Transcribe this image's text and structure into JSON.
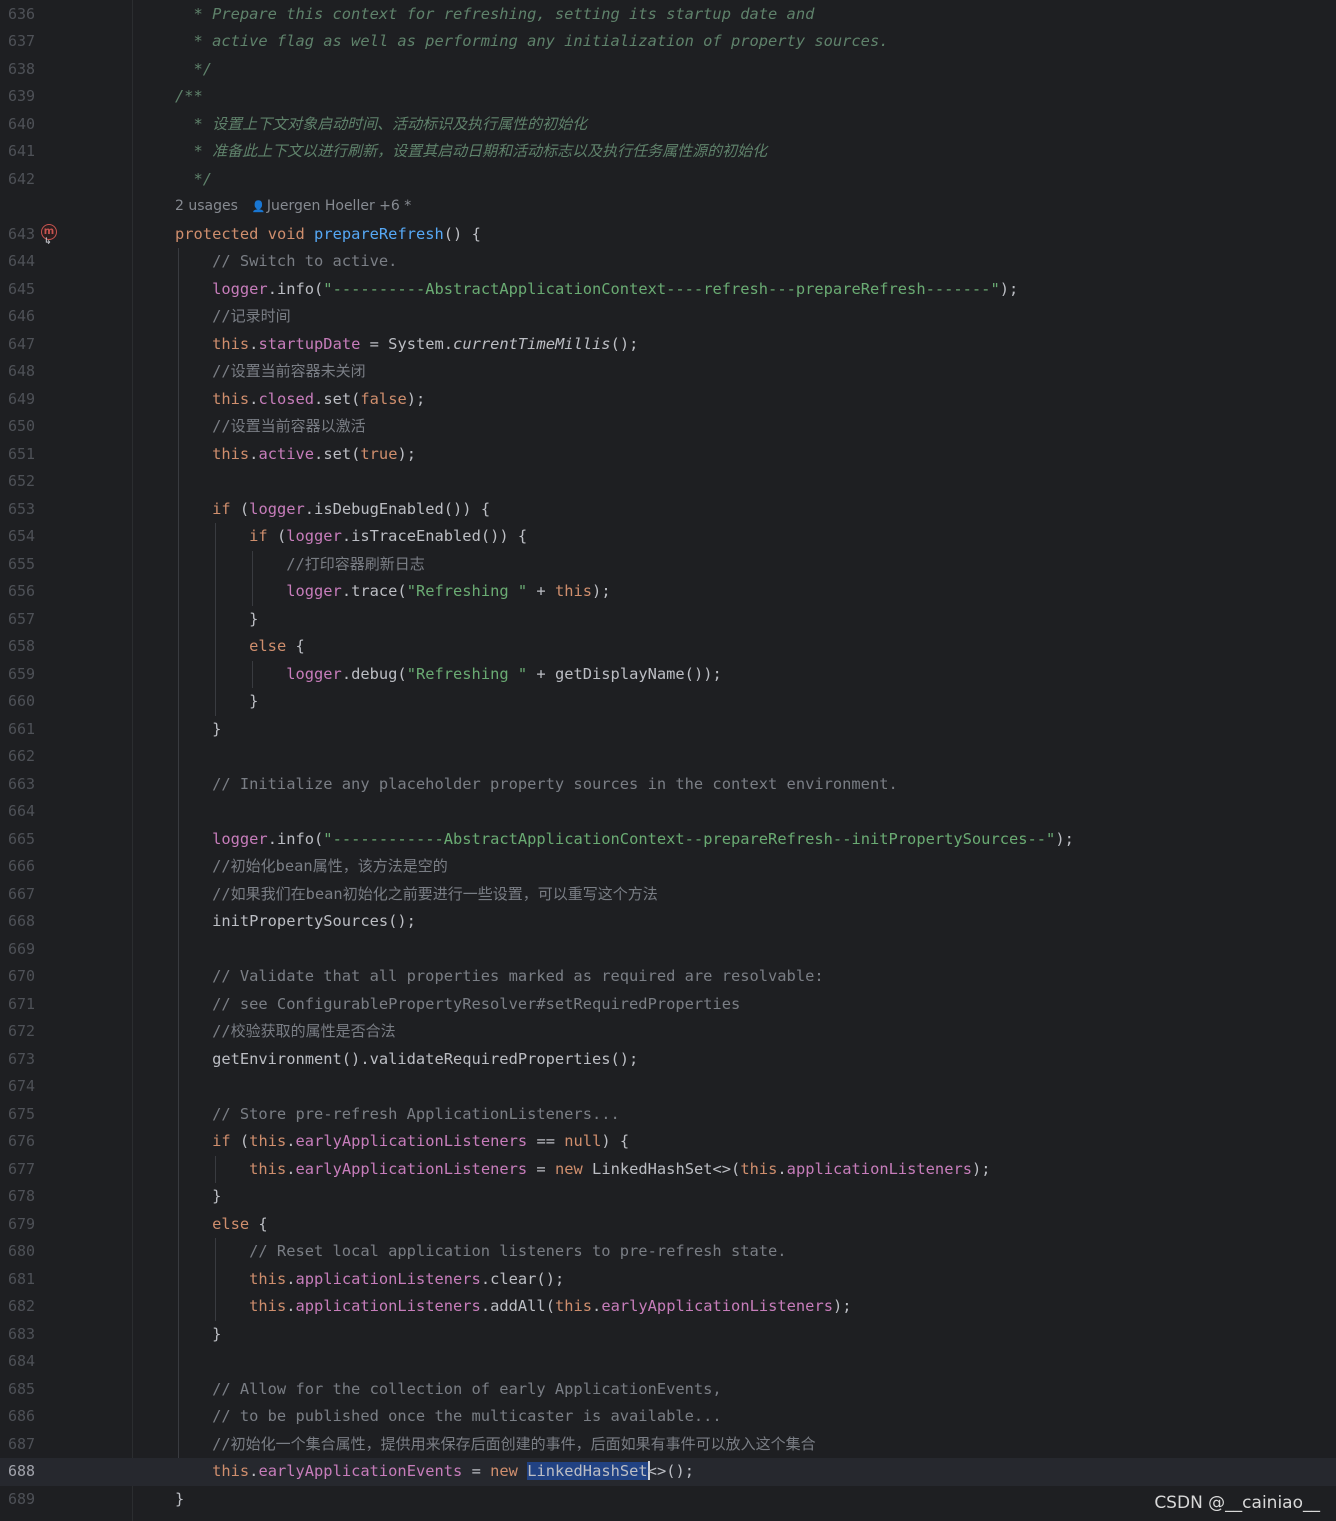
{
  "editor": {
    "inlay": {
      "usages": "2 usages",
      "author": "Juergen Hoeller +6 *"
    },
    "gutter_icon_label": "m",
    "current_line": 688,
    "lines": [
      {
        "n": "636",
        "t": [
          [
            "  * Prepare this context for refreshing, setting its startup date and",
            "doc"
          ]
        ]
      },
      {
        "n": "637",
        "t": [
          [
            "  * active flag as well as performing any initialization of property sources.",
            "doc"
          ]
        ]
      },
      {
        "n": "638",
        "t": [
          [
            "  */",
            "doc"
          ]
        ]
      },
      {
        "n": "639",
        "t": [
          [
            "/**",
            "doc"
          ]
        ]
      },
      {
        "n": "640",
        "t": [
          [
            "  * ",
            "doc"
          ],
          [
            "设置上下文对象启动时间、活动标识及执行属性的初始化",
            "doc-cjk"
          ]
        ]
      },
      {
        "n": "641",
        "t": [
          [
            "  * ",
            "doc"
          ],
          [
            "准备此上下文以进行刷新，设置其启动日期和活动标志以及执行任务属性源的初始化",
            "doc-cjk"
          ]
        ]
      },
      {
        "n": "642",
        "t": [
          [
            "  */",
            "doc"
          ]
        ]
      },
      {
        "n": "643",
        "t": [
          [
            "protected",
            "kw"
          ],
          [
            " ",
            ""
          ],
          [
            "void",
            "kw"
          ],
          [
            " ",
            ""
          ],
          [
            "prepareRefresh",
            "fn"
          ],
          [
            "() {",
            ""
          ]
        ]
      },
      {
        "n": "644",
        "t": [
          [
            "    // Switch to active.",
            "cmt"
          ]
        ]
      },
      {
        "n": "645",
        "t": [
          [
            "    ",
            ""
          ],
          [
            "logger",
            "fld"
          ],
          [
            ".info(",
            ""
          ],
          [
            "\"----------AbstractApplicationContext----refresh---prepareRefresh-------\"",
            "str"
          ],
          [
            ");",
            ""
          ]
        ]
      },
      {
        "n": "646",
        "t": [
          [
            "    //",
            "cmt"
          ],
          [
            "记录时间",
            "cmt-cjk"
          ]
        ]
      },
      {
        "n": "647",
        "t": [
          [
            "    ",
            ""
          ],
          [
            "this",
            "kw"
          ],
          [
            ".",
            ""
          ],
          [
            "startupDate",
            "fld"
          ],
          [
            " = System.",
            ""
          ],
          [
            "currentTimeMillis",
            "ital"
          ],
          [
            "();",
            ""
          ]
        ]
      },
      {
        "n": "648",
        "t": [
          [
            "    //",
            "cmt"
          ],
          [
            "设置当前容器未关闭",
            "cmt-cjk"
          ]
        ]
      },
      {
        "n": "649",
        "t": [
          [
            "    ",
            ""
          ],
          [
            "this",
            "kw"
          ],
          [
            ".",
            ""
          ],
          [
            "closed",
            "fld"
          ],
          [
            ".set(",
            ""
          ],
          [
            "false",
            "kw"
          ],
          [
            ");",
            ""
          ]
        ]
      },
      {
        "n": "650",
        "t": [
          [
            "    //",
            "cmt"
          ],
          [
            "设置当前容器以激活",
            "cmt-cjk"
          ]
        ]
      },
      {
        "n": "651",
        "t": [
          [
            "    ",
            ""
          ],
          [
            "this",
            "kw"
          ],
          [
            ".",
            ""
          ],
          [
            "active",
            "fld"
          ],
          [
            ".set(",
            ""
          ],
          [
            "true",
            "kw"
          ],
          [
            ");",
            ""
          ]
        ]
      },
      {
        "n": "652",
        "t": []
      },
      {
        "n": "653",
        "t": [
          [
            "    ",
            ""
          ],
          [
            "if",
            "kw"
          ],
          [
            " (",
            ""
          ],
          [
            "logger",
            "fld"
          ],
          [
            ".isDebugEnabled()) {",
            ""
          ]
        ]
      },
      {
        "n": "654",
        "t": [
          [
            "        ",
            ""
          ],
          [
            "if",
            "kw"
          ],
          [
            " (",
            ""
          ],
          [
            "logger",
            "fld"
          ],
          [
            ".isTraceEnabled()) {",
            ""
          ]
        ]
      },
      {
        "n": "655",
        "t": [
          [
            "            //",
            "cmt"
          ],
          [
            "打印容器刷新日志",
            "cmt-cjk"
          ]
        ]
      },
      {
        "n": "656",
        "t": [
          [
            "            ",
            ""
          ],
          [
            "logger",
            "fld"
          ],
          [
            ".trace(",
            ""
          ],
          [
            "\"Refreshing \"",
            "str"
          ],
          [
            " + ",
            ""
          ],
          [
            "this",
            "kw"
          ],
          [
            ");",
            ""
          ]
        ]
      },
      {
        "n": "657",
        "t": [
          [
            "        }",
            ""
          ]
        ]
      },
      {
        "n": "658",
        "t": [
          [
            "        ",
            ""
          ],
          [
            "else",
            "kw"
          ],
          [
            " {",
            ""
          ]
        ]
      },
      {
        "n": "659",
        "t": [
          [
            "            ",
            ""
          ],
          [
            "logger",
            "fld"
          ],
          [
            ".debug(",
            ""
          ],
          [
            "\"Refreshing \"",
            "str"
          ],
          [
            " + getDisplayName());",
            ""
          ]
        ]
      },
      {
        "n": "660",
        "t": [
          [
            "        }",
            ""
          ]
        ]
      },
      {
        "n": "661",
        "t": [
          [
            "    }",
            ""
          ]
        ]
      },
      {
        "n": "662",
        "t": []
      },
      {
        "n": "663",
        "t": [
          [
            "    // Initialize any placeholder property sources in the context environment.",
            "cmt"
          ]
        ]
      },
      {
        "n": "664",
        "t": []
      },
      {
        "n": "665",
        "t": [
          [
            "    ",
            ""
          ],
          [
            "logger",
            "fld"
          ],
          [
            ".info(",
            ""
          ],
          [
            "\"------------AbstractApplicationContext--prepareRefresh--initPropertySources--\"",
            "str"
          ],
          [
            ");",
            ""
          ]
        ]
      },
      {
        "n": "666",
        "t": [
          [
            "    //",
            "cmt"
          ],
          [
            "初始化",
            "cmt-cjk"
          ],
          [
            "bean",
            "cmt"
          ],
          [
            "属性，该方法是空的",
            "cmt-cjk"
          ]
        ]
      },
      {
        "n": "667",
        "t": [
          [
            "    //",
            "cmt"
          ],
          [
            "如果我们在",
            "cmt-cjk"
          ],
          [
            "bean",
            "cmt"
          ],
          [
            "初始化之前要进行一些设置，可以重写这个方法",
            "cmt-cjk"
          ]
        ]
      },
      {
        "n": "668",
        "t": [
          [
            "    initPropertySources();",
            ""
          ]
        ]
      },
      {
        "n": "669",
        "t": []
      },
      {
        "n": "670",
        "t": [
          [
            "    // Validate that all properties marked as required are resolvable:",
            "cmt"
          ]
        ]
      },
      {
        "n": "671",
        "t": [
          [
            "    // see ConfigurablePropertyResolver#setRequiredProperties",
            "cmt"
          ]
        ]
      },
      {
        "n": "672",
        "t": [
          [
            "    //",
            "cmt"
          ],
          [
            "校验获取的属性是否合法",
            "cmt-cjk"
          ]
        ]
      },
      {
        "n": "673",
        "t": [
          [
            "    getEnvironment().validateRequiredProperties();",
            ""
          ]
        ]
      },
      {
        "n": "674",
        "t": []
      },
      {
        "n": "675",
        "t": [
          [
            "    // Store pre-refresh ApplicationListeners...",
            "cmt"
          ]
        ]
      },
      {
        "n": "676",
        "t": [
          [
            "    ",
            ""
          ],
          [
            "if",
            "kw"
          ],
          [
            " (",
            ""
          ],
          [
            "this",
            "kw"
          ],
          [
            ".",
            ""
          ],
          [
            "earlyApplicationListeners",
            "fld"
          ],
          [
            " == ",
            ""
          ],
          [
            "null",
            "kw"
          ],
          [
            ") {",
            ""
          ]
        ]
      },
      {
        "n": "677",
        "t": [
          [
            "        ",
            ""
          ],
          [
            "this",
            "kw"
          ],
          [
            ".",
            ""
          ],
          [
            "earlyApplicationListeners",
            "fld"
          ],
          [
            " = ",
            ""
          ],
          [
            "new",
            "kw"
          ],
          [
            " LinkedHashSet<>(",
            ""
          ],
          [
            "this",
            "kw"
          ],
          [
            ".",
            ""
          ],
          [
            "applicationListeners",
            "fld"
          ],
          [
            ");",
            ""
          ]
        ]
      },
      {
        "n": "678",
        "t": [
          [
            "    }",
            ""
          ]
        ]
      },
      {
        "n": "679",
        "t": [
          [
            "    ",
            ""
          ],
          [
            "else",
            "kw"
          ],
          [
            " {",
            ""
          ]
        ]
      },
      {
        "n": "680",
        "t": [
          [
            "        // Reset local application listeners to pre-refresh state.",
            "cmt"
          ]
        ]
      },
      {
        "n": "681",
        "t": [
          [
            "        ",
            ""
          ],
          [
            "this",
            "kw"
          ],
          [
            ".",
            ""
          ],
          [
            "applicationListeners",
            "fld"
          ],
          [
            ".clear();",
            ""
          ]
        ]
      },
      {
        "n": "682",
        "t": [
          [
            "        ",
            ""
          ],
          [
            "this",
            "kw"
          ],
          [
            ".",
            ""
          ],
          [
            "applicationListeners",
            "fld"
          ],
          [
            ".addAll(",
            ""
          ],
          [
            "this",
            "kw"
          ],
          [
            ".",
            ""
          ],
          [
            "earlyApplicationListeners",
            "fld"
          ],
          [
            ");",
            ""
          ]
        ]
      },
      {
        "n": "683",
        "t": [
          [
            "    }",
            ""
          ]
        ]
      },
      {
        "n": "684",
        "t": []
      },
      {
        "n": "685",
        "t": [
          [
            "    // Allow for the collection of early ApplicationEvents,",
            "cmt"
          ]
        ]
      },
      {
        "n": "686",
        "t": [
          [
            "    // to be published once the multicaster is available...",
            "cmt"
          ]
        ]
      },
      {
        "n": "687",
        "t": [
          [
            "    //",
            "cmt"
          ],
          [
            "初始化一个集合属性，提供用来保存后面创建的事件，后面如果有事件可以放入这个集合",
            "cmt-cjk"
          ]
        ]
      },
      {
        "n": "688",
        "t": [
          [
            "    ",
            ""
          ],
          [
            "this",
            "kw"
          ],
          [
            ".",
            ""
          ],
          [
            "earlyApplicationEvents",
            "fld"
          ],
          [
            " = ",
            ""
          ],
          [
            "new",
            "kw"
          ],
          [
            " ",
            ""
          ],
          [
            "LinkedHashSet",
            "sel"
          ],
          [
            "|",
            "caret"
          ],
          [
            "<>();",
            ""
          ]
        ]
      },
      {
        "n": "689",
        "t": [
          [
            "}",
            ""
          ]
        ]
      }
    ]
  },
  "watermark": "CSDN @__cainiao__",
  "colors": {
    "background": "#1e1f22",
    "keyword": "#cf8e6d",
    "field": "#c77dbb",
    "method_declaration": "#56a8f5",
    "string": "#6aab73",
    "comment": "#7a7e85",
    "doc_comment": "#5f826b",
    "selection": "#214283"
  }
}
